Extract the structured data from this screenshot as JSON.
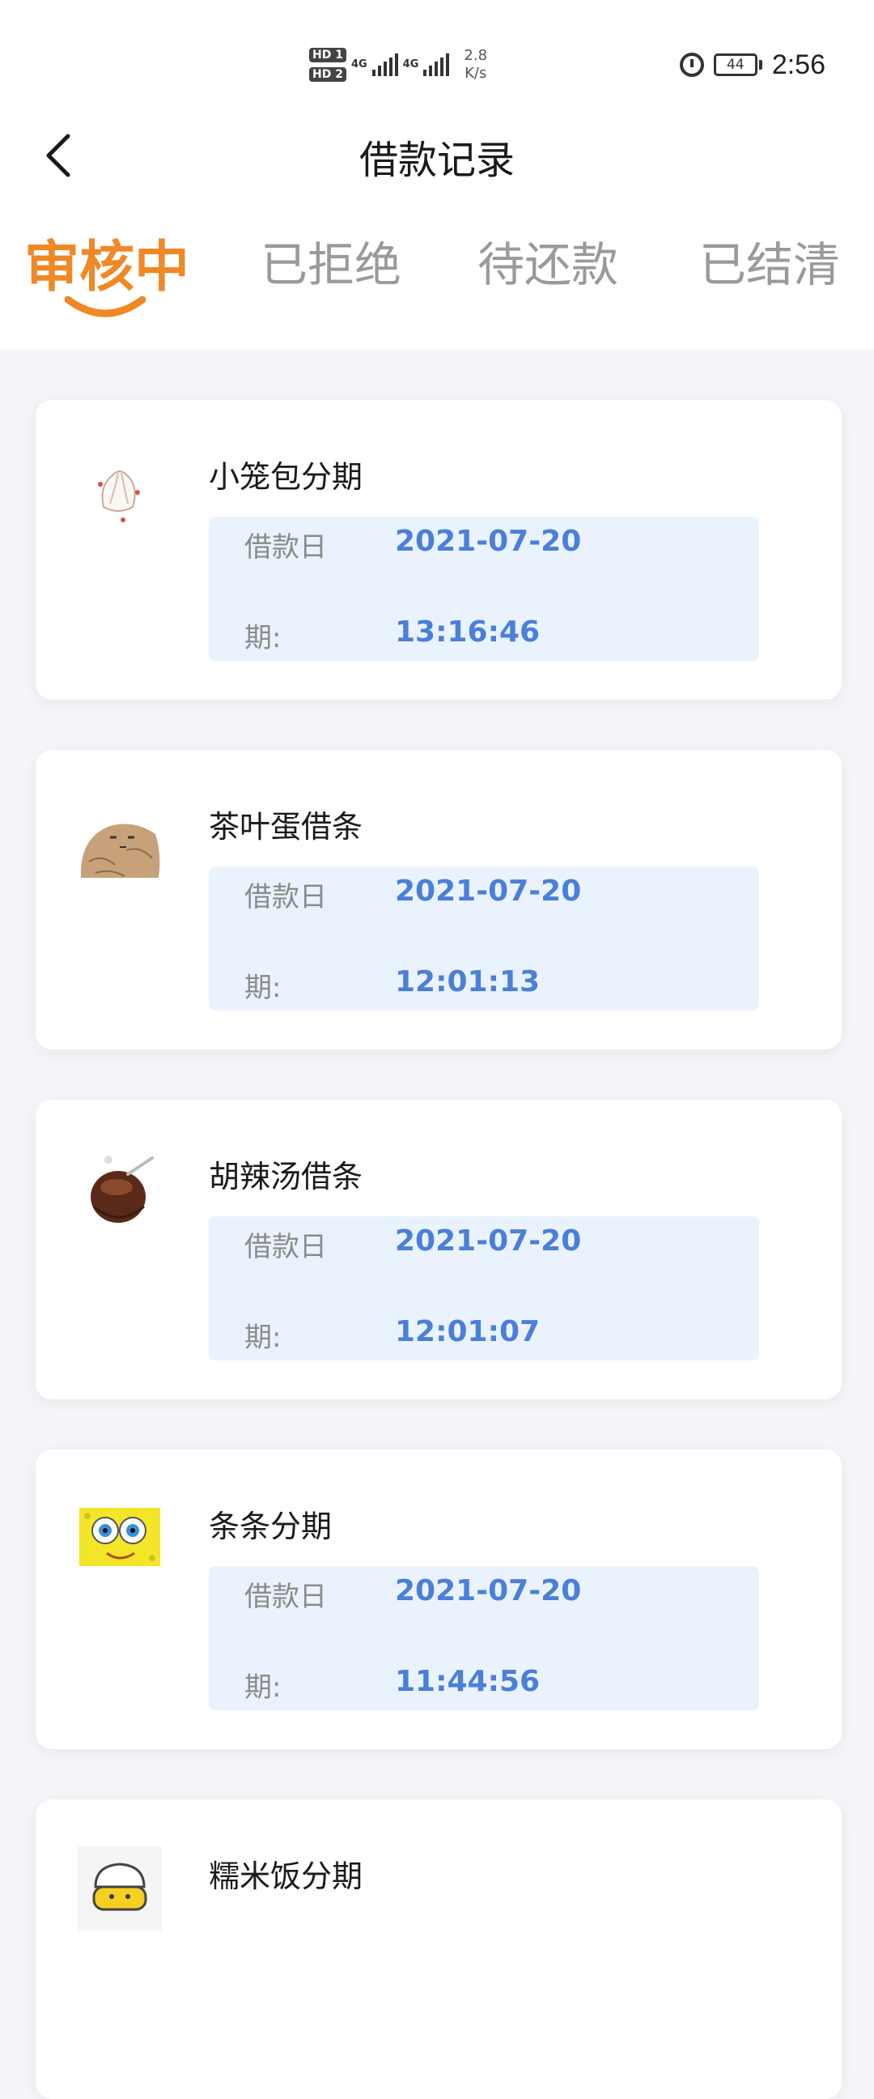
{
  "status_bar": {
    "hd1": "HD 1",
    "hd2": "HD 2",
    "net1": "4G",
    "net2": "4G",
    "speed_value": "2.8",
    "speed_unit": "K/s",
    "battery": "44",
    "time": "2:56"
  },
  "header": {
    "title": "借款记录",
    "back_icon": "chevron-left-icon"
  },
  "tabs": [
    {
      "label": "审核中",
      "active": true
    },
    {
      "label": "已拒绝",
      "active": false
    },
    {
      "label": "待还款",
      "active": false
    },
    {
      "label": "已结清",
      "active": false
    }
  ],
  "colors": {
    "accent": "#f08826",
    "value_blue": "#4a7fda",
    "info_bg": "#eaf3fd"
  },
  "records": [
    {
      "name": "小笼包分期",
      "date_label": "借款日",
      "date": "2021-07-20",
      "period_label": "期:",
      "time": "13:16:46",
      "icon": "steamed-bun-icon"
    },
    {
      "name": "茶叶蛋借条",
      "date_label": "借款日",
      "date": "2021-07-20",
      "period_label": "期:",
      "time": "12:01:13",
      "icon": "tea-egg-icon"
    },
    {
      "name": "胡辣汤借条",
      "date_label": "借款日",
      "date": "2021-07-20",
      "period_label": "期:",
      "time": "12:01:07",
      "icon": "soup-bowl-icon"
    },
    {
      "name": "条条分期",
      "date_label": "借款日",
      "date": "2021-07-20",
      "period_label": "期:",
      "time": "11:44:56",
      "icon": "sponge-face-icon"
    },
    {
      "name": "糯米饭分期",
      "icon": "rice-bowl-icon"
    }
  ]
}
